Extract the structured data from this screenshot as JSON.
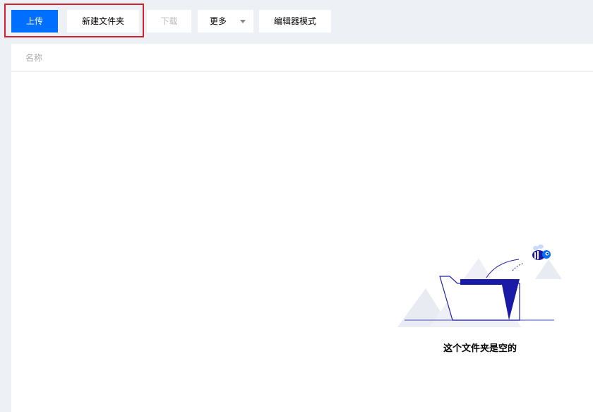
{
  "toolbar": {
    "upload_label": "上传",
    "new_folder_label": "新建文件夹",
    "download_label": "下载",
    "more_label": "更多",
    "editor_mode_label": "编辑器模式"
  },
  "table": {
    "columns": [
      "名称"
    ]
  },
  "empty_state": {
    "message": "这个文件夹是空的"
  },
  "colors": {
    "primary": "#006eff",
    "highlight_border": "#d4222b",
    "background": "#edf0f4",
    "folder_dark": "#1a1aa6"
  }
}
